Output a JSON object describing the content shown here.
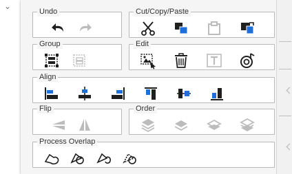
{
  "groups": {
    "undo": {
      "title": "Undo"
    },
    "cutcopy": {
      "title": "Cut/Copy/Paste"
    },
    "group": {
      "title": "Group"
    },
    "edit": {
      "title": "Edit"
    },
    "align": {
      "title": "Align"
    },
    "flip": {
      "title": "Flip"
    },
    "order": {
      "title": "Order"
    },
    "overlap": {
      "title": "Process Overlap"
    }
  },
  "colors": {
    "icon_dark": "#1f1f1f",
    "icon_disabled": "#bcbcbc",
    "accent_blue": "#1e6fd9",
    "panel_bg": "#f5f5f5"
  },
  "icons": {
    "undo": [
      "undo-arrow-icon",
      "redo-arrow-icon"
    ],
    "cutcopy": [
      "scissors-icon",
      "copy-icon",
      "paste-icon",
      "paste-special-icon"
    ],
    "group": [
      "group-icon",
      "ungroup-icon"
    ],
    "edit": [
      "select-edit-icon",
      "trash-icon",
      "text-icon",
      "attach-icon"
    ],
    "align": [
      "align-left-icon",
      "align-center-icon",
      "align-right-icon",
      "align-top-icon",
      "align-middle-icon",
      "align-bottom-icon"
    ],
    "flip": [
      "flip-vertical-icon",
      "flip-horizontal-icon"
    ],
    "order": [
      "bring-to-front-icon",
      "bring-forward-icon",
      "send-backward-icon",
      "send-to-back-icon"
    ],
    "overlap": [
      "overlap-union-icon",
      "overlap-subtract-icon",
      "overlap-intersect-icon",
      "overlap-exclude-icon"
    ]
  }
}
